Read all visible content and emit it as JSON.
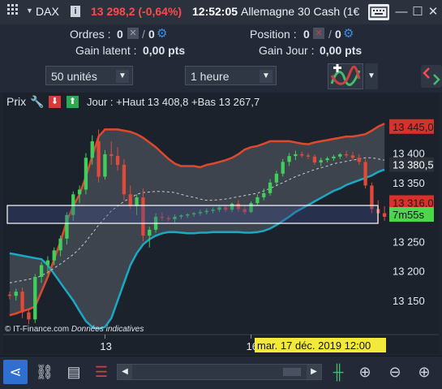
{
  "titlebar": {
    "menu_icon": "grid-menu-icon",
    "symbol": "DAX",
    "info_icon": "info-icon",
    "price": "13 298,2 (-0,64%)",
    "time": "12:52:05",
    "instrument": "Allemagne 30 Cash (1€",
    "window_icons": [
      "keyboard-icon",
      "minimize-icon",
      "maximize-icon",
      "close-icon"
    ]
  },
  "info": {
    "ordres_label": "Ordres :",
    "ordres_count": "0",
    "ordres_count2": "0",
    "position_label": "Position :",
    "position_count": "0",
    "position_count2": "0",
    "gain_latent_label": "Gain latent :",
    "gain_latent_value": "0,00 pts",
    "gain_jour_label": "Gain Jour :",
    "gain_jour_value": "0,00 pts"
  },
  "toolbar": {
    "units_value": "50 unités",
    "period_value": "1 heure"
  },
  "chart": {
    "prix_label": "Prix",
    "legend": "Jour : +Haut 13 408,8 +Bas 13 267,7",
    "copyright": "© IT-Finance.com",
    "note": "Données indicatives",
    "price_labels": [
      {
        "text": "13 445,0",
        "value": 13445,
        "kind": "tag-red"
      },
      {
        "text": "13 400",
        "value": 13400,
        "kind": "tick"
      },
      {
        "text": "13 380,5",
        "value": 13380.5,
        "kind": "tag-dark"
      },
      {
        "text": "13 350",
        "value": 13350,
        "kind": "tick"
      },
      {
        "text": "13 316,0",
        "value": 13316,
        "kind": "tag-red"
      },
      {
        "text": "7m55s",
        "value": 13296,
        "kind": "tag-green"
      },
      {
        "text": "13 250",
        "value": 13250,
        "kind": "tick"
      },
      {
        "text": "13 200",
        "value": 13200,
        "kind": "tick"
      },
      {
        "text": "13 150",
        "value": 13150,
        "kind": "tick"
      }
    ],
    "time_labels": [
      {
        "text": "13",
        "index": 15
      },
      {
        "text": "16",
        "index": 38
      }
    ],
    "crosshair_date": "mar. 17 déc. 2019 12:00"
  },
  "chart_data": {
    "type": "candlestick",
    "y_range": [
      13095,
      13475
    ],
    "series_bb_upper": [
      13125,
      13128,
      13132,
      13135,
      13140,
      13165,
      13190,
      13220,
      13250,
      13285,
      13310,
      13330,
      13360,
      13395,
      13428,
      13440,
      13440,
      13440,
      13438,
      13436,
      13432,
      13426,
      13418,
      13410,
      13400,
      13390,
      13382,
      13378,
      13378,
      13378,
      13376,
      13380,
      13382,
      13385,
      13388,
      13392,
      13398,
      13406,
      13410,
      13412,
      13416,
      13420,
      13420,
      13420,
      13420,
      13418,
      13416,
      13415,
      13418,
      13420,
      13422,
      13424,
      13426,
      13428,
      13428,
      13430,
      13432,
      13438,
      13445,
      13450
    ],
    "series_bb_mid": [
      13180,
      13182,
      13184,
      13186,
      13188,
      13192,
      13198,
      13205,
      13212,
      13220,
      13228,
      13238,
      13250,
      13264,
      13278,
      13290,
      13302,
      13310,
      13318,
      13324,
      13330,
      13333,
      13334,
      13335,
      13335,
      13334,
      13333,
      13330,
      13327,
      13325,
      13322,
      13320,
      13320,
      13321,
      13322,
      13324,
      13326,
      13328,
      13330,
      13332,
      13336,
      13340,
      13345,
      13350,
      13355,
      13360,
      13364,
      13368,
      13372,
      13375,
      13378,
      13382,
      13384,
      13386,
      13388,
      13390,
      13392,
      13392,
      13390,
      13388
    ],
    "series_bb_lower": [
      13230,
      13228,
      13226,
      13224,
      13222,
      13220,
      13210,
      13195,
      13180,
      13165,
      13150,
      13132,
      13115,
      13105,
      13102,
      13105,
      13120,
      13150,
      13180,
      13210,
      13230,
      13245,
      13254,
      13260,
      13264,
      13266,
      13266,
      13265,
      13264,
      13264,
      13265,
      13265,
      13266,
      13266,
      13266,
      13266,
      13266,
      13265,
      13265,
      13266,
      13268,
      13272,
      13278,
      13285,
      13292,
      13300,
      13306,
      13312,
      13318,
      13324,
      13330,
      13336,
      13340,
      13346,
      13350,
      13354,
      13358,
      13362,
      13368,
      13372
    ],
    "candles": [
      [
        13160,
        13165,
        13152,
        13158
      ],
      [
        13158,
        13170,
        13150,
        13165
      ],
      [
        13165,
        13172,
        13120,
        13130
      ],
      [
        13130,
        13135,
        13110,
        13118
      ],
      [
        13118,
        13195,
        13112,
        13190
      ],
      [
        13190,
        13215,
        13180,
        13210
      ],
      [
        13210,
        13225,
        13195,
        13218
      ],
      [
        13218,
        13240,
        13210,
        13235
      ],
      [
        13235,
        13260,
        13225,
        13255
      ],
      [
        13255,
        13300,
        13245,
        13295
      ],
      [
        13295,
        13335,
        13285,
        13330
      ],
      [
        13330,
        13345,
        13315,
        13338
      ],
      [
        13338,
        13400,
        13330,
        13392
      ],
      [
        13392,
        13430,
        13380,
        13420
      ],
      [
        13420,
        13440,
        13350,
        13360
      ],
      [
        13360,
        13405,
        13355,
        13398
      ],
      [
        13398,
        13420,
        13380,
        13395
      ],
      [
        13395,
        13410,
        13370,
        13380
      ],
      [
        13380,
        13390,
        13320,
        13330
      ],
      [
        13330,
        13345,
        13305,
        13310
      ],
      [
        13310,
        13330,
        13295,
        13325
      ],
      [
        13325,
        13340,
        13250,
        13260
      ],
      [
        13260,
        13275,
        13240,
        13270
      ],
      [
        13270,
        13298,
        13265,
        13292
      ],
      [
        13292,
        13300,
        13285,
        13290
      ],
      [
        13290,
        13294,
        13284,
        13288
      ],
      [
        13288,
        13296,
        13282,
        13292
      ],
      [
        13292,
        13296,
        13288,
        13294
      ],
      [
        13294,
        13298,
        13290,
        13296
      ],
      [
        13296,
        13300,
        13292,
        13298
      ],
      [
        13298,
        13304,
        13294,
        13300
      ],
      [
        13300,
        13306,
        13296,
        13302
      ],
      [
        13302,
        13308,
        13298,
        13304
      ],
      [
        13304,
        13310,
        13300,
        13308
      ],
      [
        13308,
        13312,
        13300,
        13304
      ],
      [
        13304,
        13316,
        13300,
        13314
      ],
      [
        13314,
        13320,
        13300,
        13305
      ],
      [
        13305,
        13310,
        13296,
        13300
      ],
      [
        13300,
        13318,
        13298,
        13315
      ],
      [
        13315,
        13330,
        13312,
        13325
      ],
      [
        13325,
        13340,
        13320,
        13332
      ],
      [
        13332,
        13356,
        13328,
        13350
      ],
      [
        13350,
        13370,
        13346,
        13365
      ],
      [
        13365,
        13390,
        13360,
        13385
      ],
      [
        13385,
        13400,
        13378,
        13395
      ],
      [
        13395,
        13404,
        13388,
        13398
      ],
      [
        13398,
        13402,
        13392,
        13396
      ],
      [
        13396,
        13400,
        13390,
        13394
      ],
      [
        13394,
        13398,
        13380,
        13384
      ],
      [
        13384,
        13392,
        13378,
        13388
      ],
      [
        13388,
        13394,
        13384,
        13391
      ],
      [
        13391,
        13397,
        13387,
        13394
      ],
      [
        13394,
        13400,
        13390,
        13398
      ],
      [
        13398,
        13404,
        13392,
        13396
      ],
      [
        13396,
        13402,
        13388,
        13392
      ],
      [
        13392,
        13398,
        13380,
        13385
      ],
      [
        13385,
        13390,
        13340,
        13345
      ],
      [
        13345,
        13350,
        13298,
        13305
      ],
      [
        13305,
        13320,
        13280,
        13298
      ],
      [
        13298,
        13310,
        13285,
        13292
      ]
    ]
  }
}
